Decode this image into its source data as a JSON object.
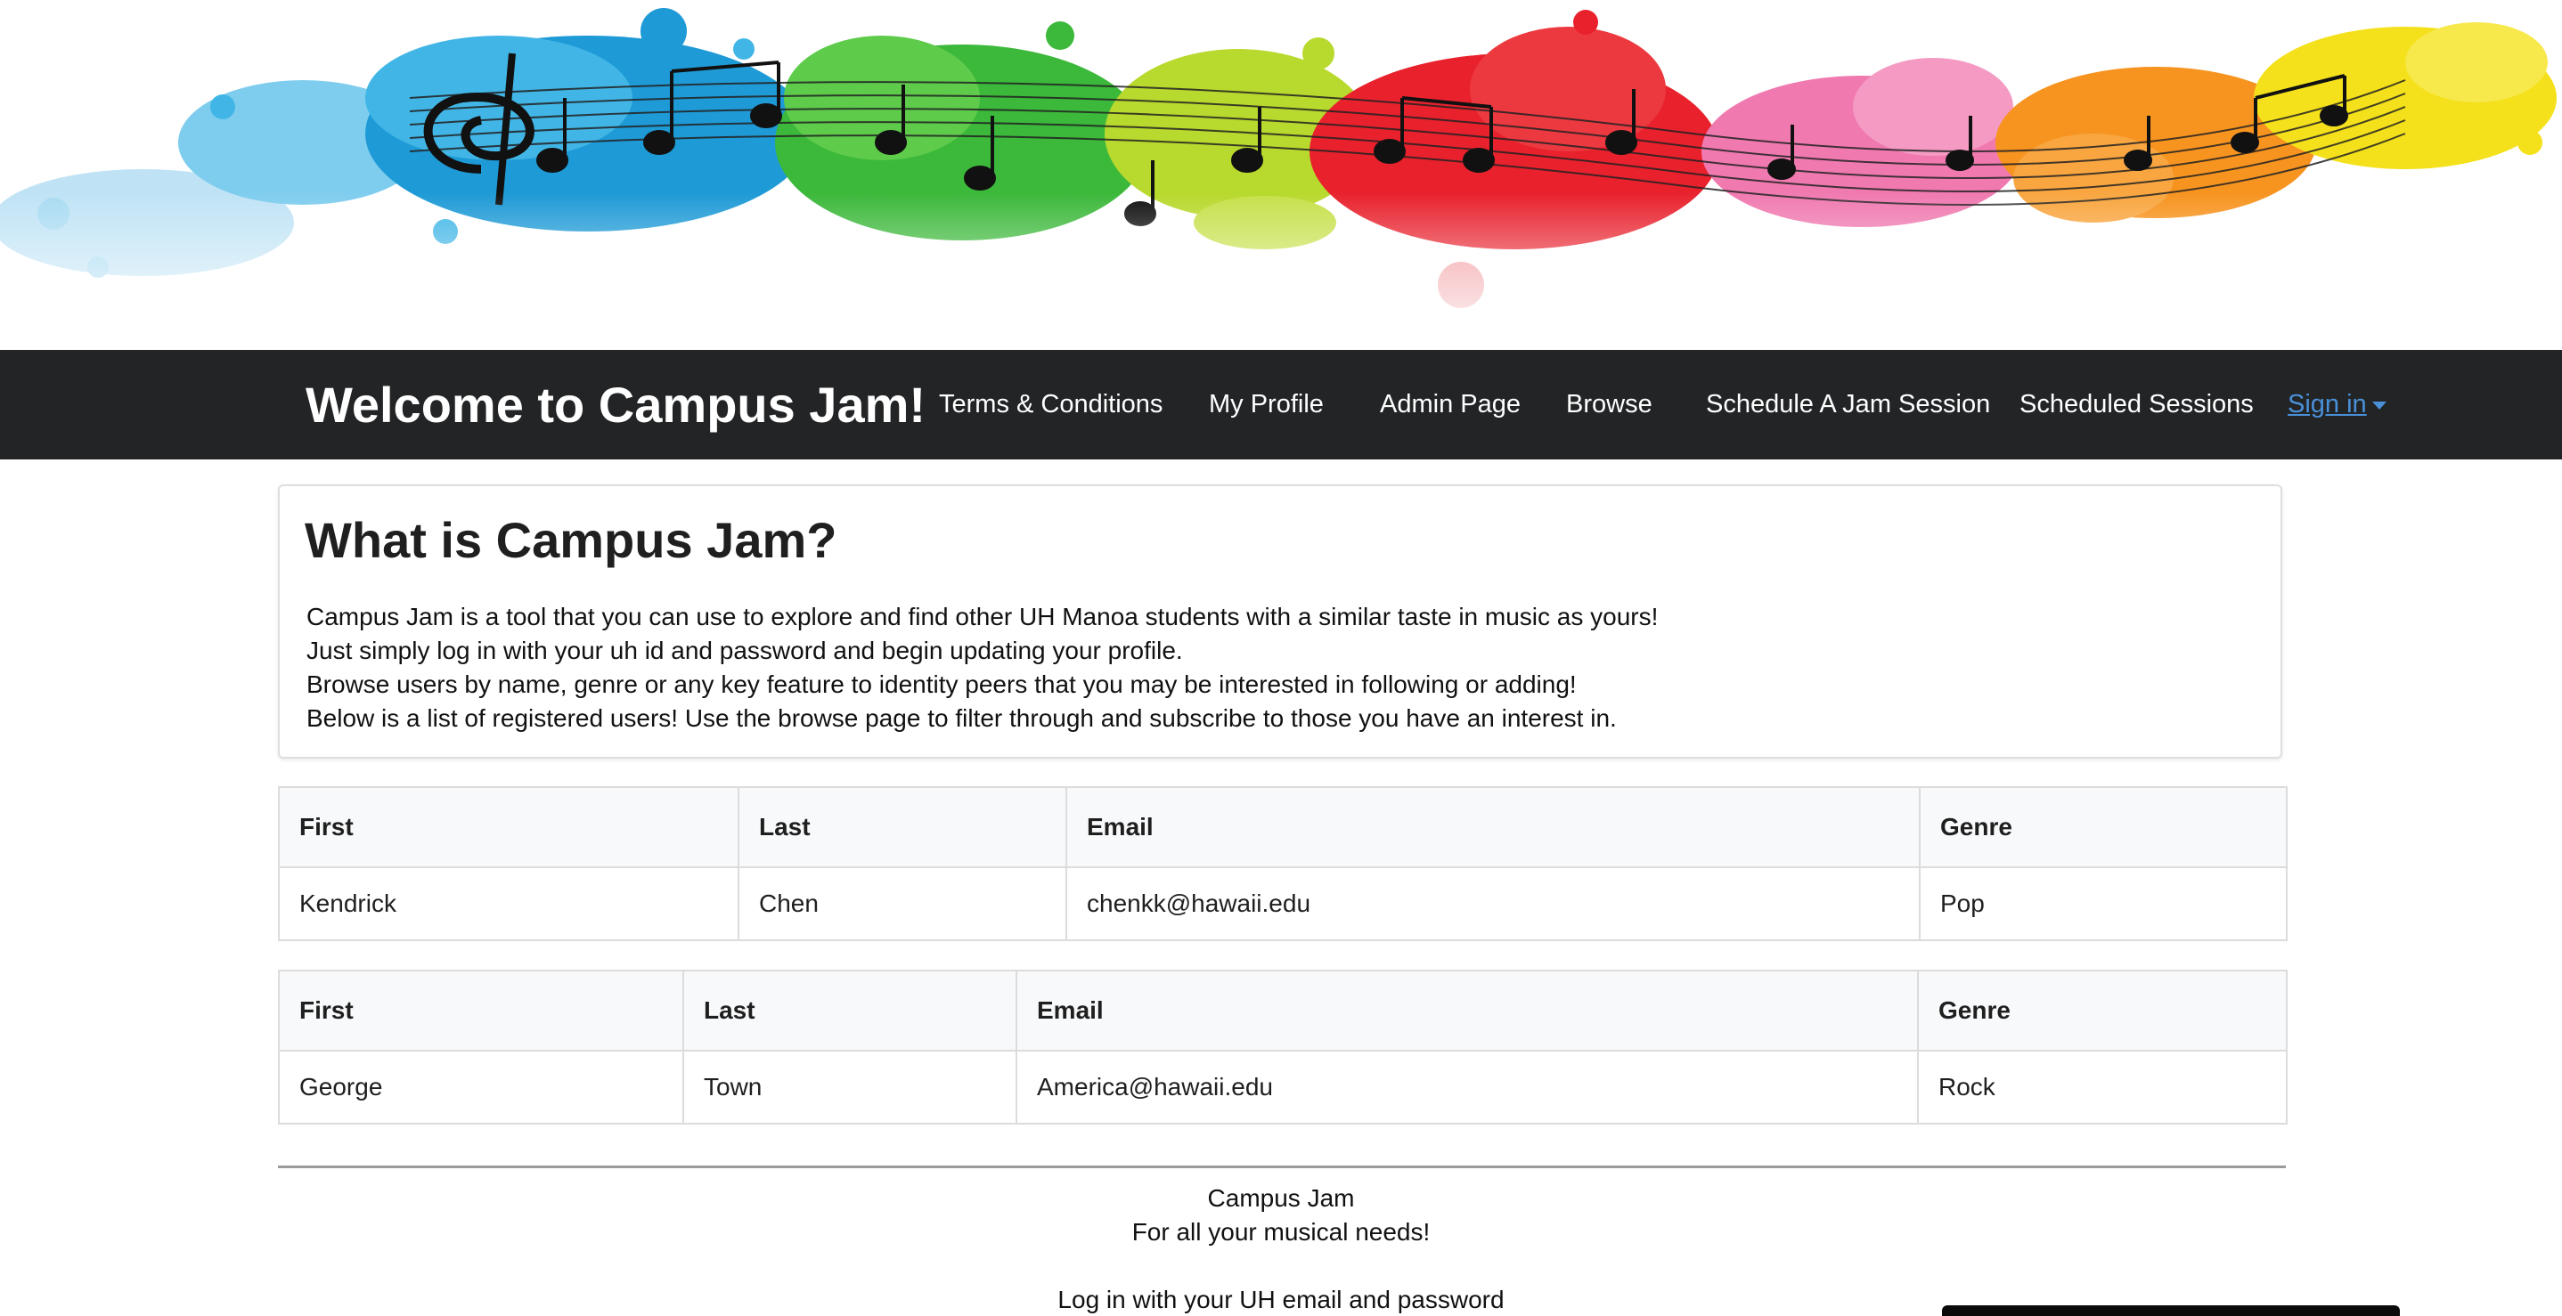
{
  "banner": {
    "alt": "colorful paint splash music notes banner",
    "colors": [
      "#41b6e6",
      "#1e90d6",
      "#4cc63f",
      "#b8d92d",
      "#e8212d",
      "#f07ab0",
      "#f79420",
      "#f4e11b"
    ]
  },
  "navbar": {
    "brand": "Welcome to Campus Jam!",
    "items": [
      {
        "label": "Terms & Conditions"
      },
      {
        "label": "My Profile"
      },
      {
        "label": "Admin Page"
      },
      {
        "label": "Browse"
      },
      {
        "label": "Schedule A Jam Session"
      },
      {
        "label": "Scheduled Sessions"
      }
    ],
    "signin": "Sign in",
    "signin_color": "#4a90d9",
    "background": "#222426"
  },
  "intro": {
    "title": "What is Campus Jam?",
    "lines": [
      "Campus Jam is a tool that you can use to explore and find other UH Manoa students with a similar taste in music as yours!",
      "Just simply log in with your uh id and password and begin updating your profile.",
      "Browse users by name, genre or any key feature to identity peers that you may be interested in following or adding!",
      "Below is a list of registered users! Use the browse page to filter through and subscribe to those you have an interest in."
    ]
  },
  "tables": [
    {
      "headers": [
        "First",
        "Last",
        "Email",
        "Genre"
      ],
      "row": [
        "Kendrick",
        "Chen",
        "chenkk@hawaii.edu",
        "Pop"
      ]
    },
    {
      "headers": [
        "First",
        "Last",
        "Email",
        "Genre"
      ],
      "row": [
        "George",
        "Town",
        "America@hawaii.edu",
        "Rock"
      ]
    }
  ],
  "footer": {
    "name": "Campus Jam",
    "tagline": "For all your musical needs!",
    "login_note": "Log in with your UH email and password"
  }
}
